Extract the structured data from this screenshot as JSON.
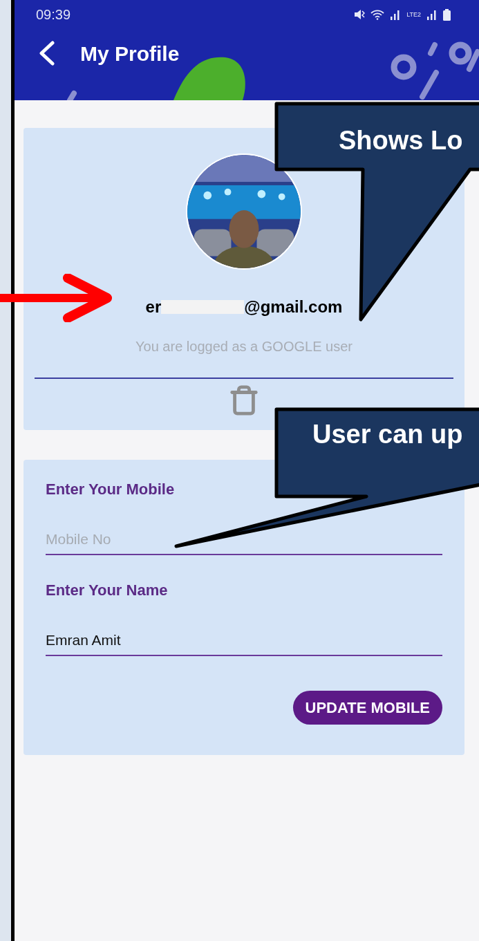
{
  "status_bar": {
    "time": "09:39",
    "network_label": "LTE2"
  },
  "app_bar": {
    "title": "My Profile"
  },
  "profile_card": {
    "email_start": "er",
    "email_end": "@gmail.com",
    "login_note": "You are logged as a GOOGLE user"
  },
  "form": {
    "fields": [
      {
        "label": "Enter Your Mobile",
        "placeholder": "Mobile No"
      },
      {
        "label": "Enter Your Name",
        "value": "Emran Amit"
      }
    ],
    "button": "UPDATE MOBILE"
  },
  "annotations": [
    {
      "text": "Shows Lo"
    },
    {
      "text": "User can up"
    }
  ]
}
